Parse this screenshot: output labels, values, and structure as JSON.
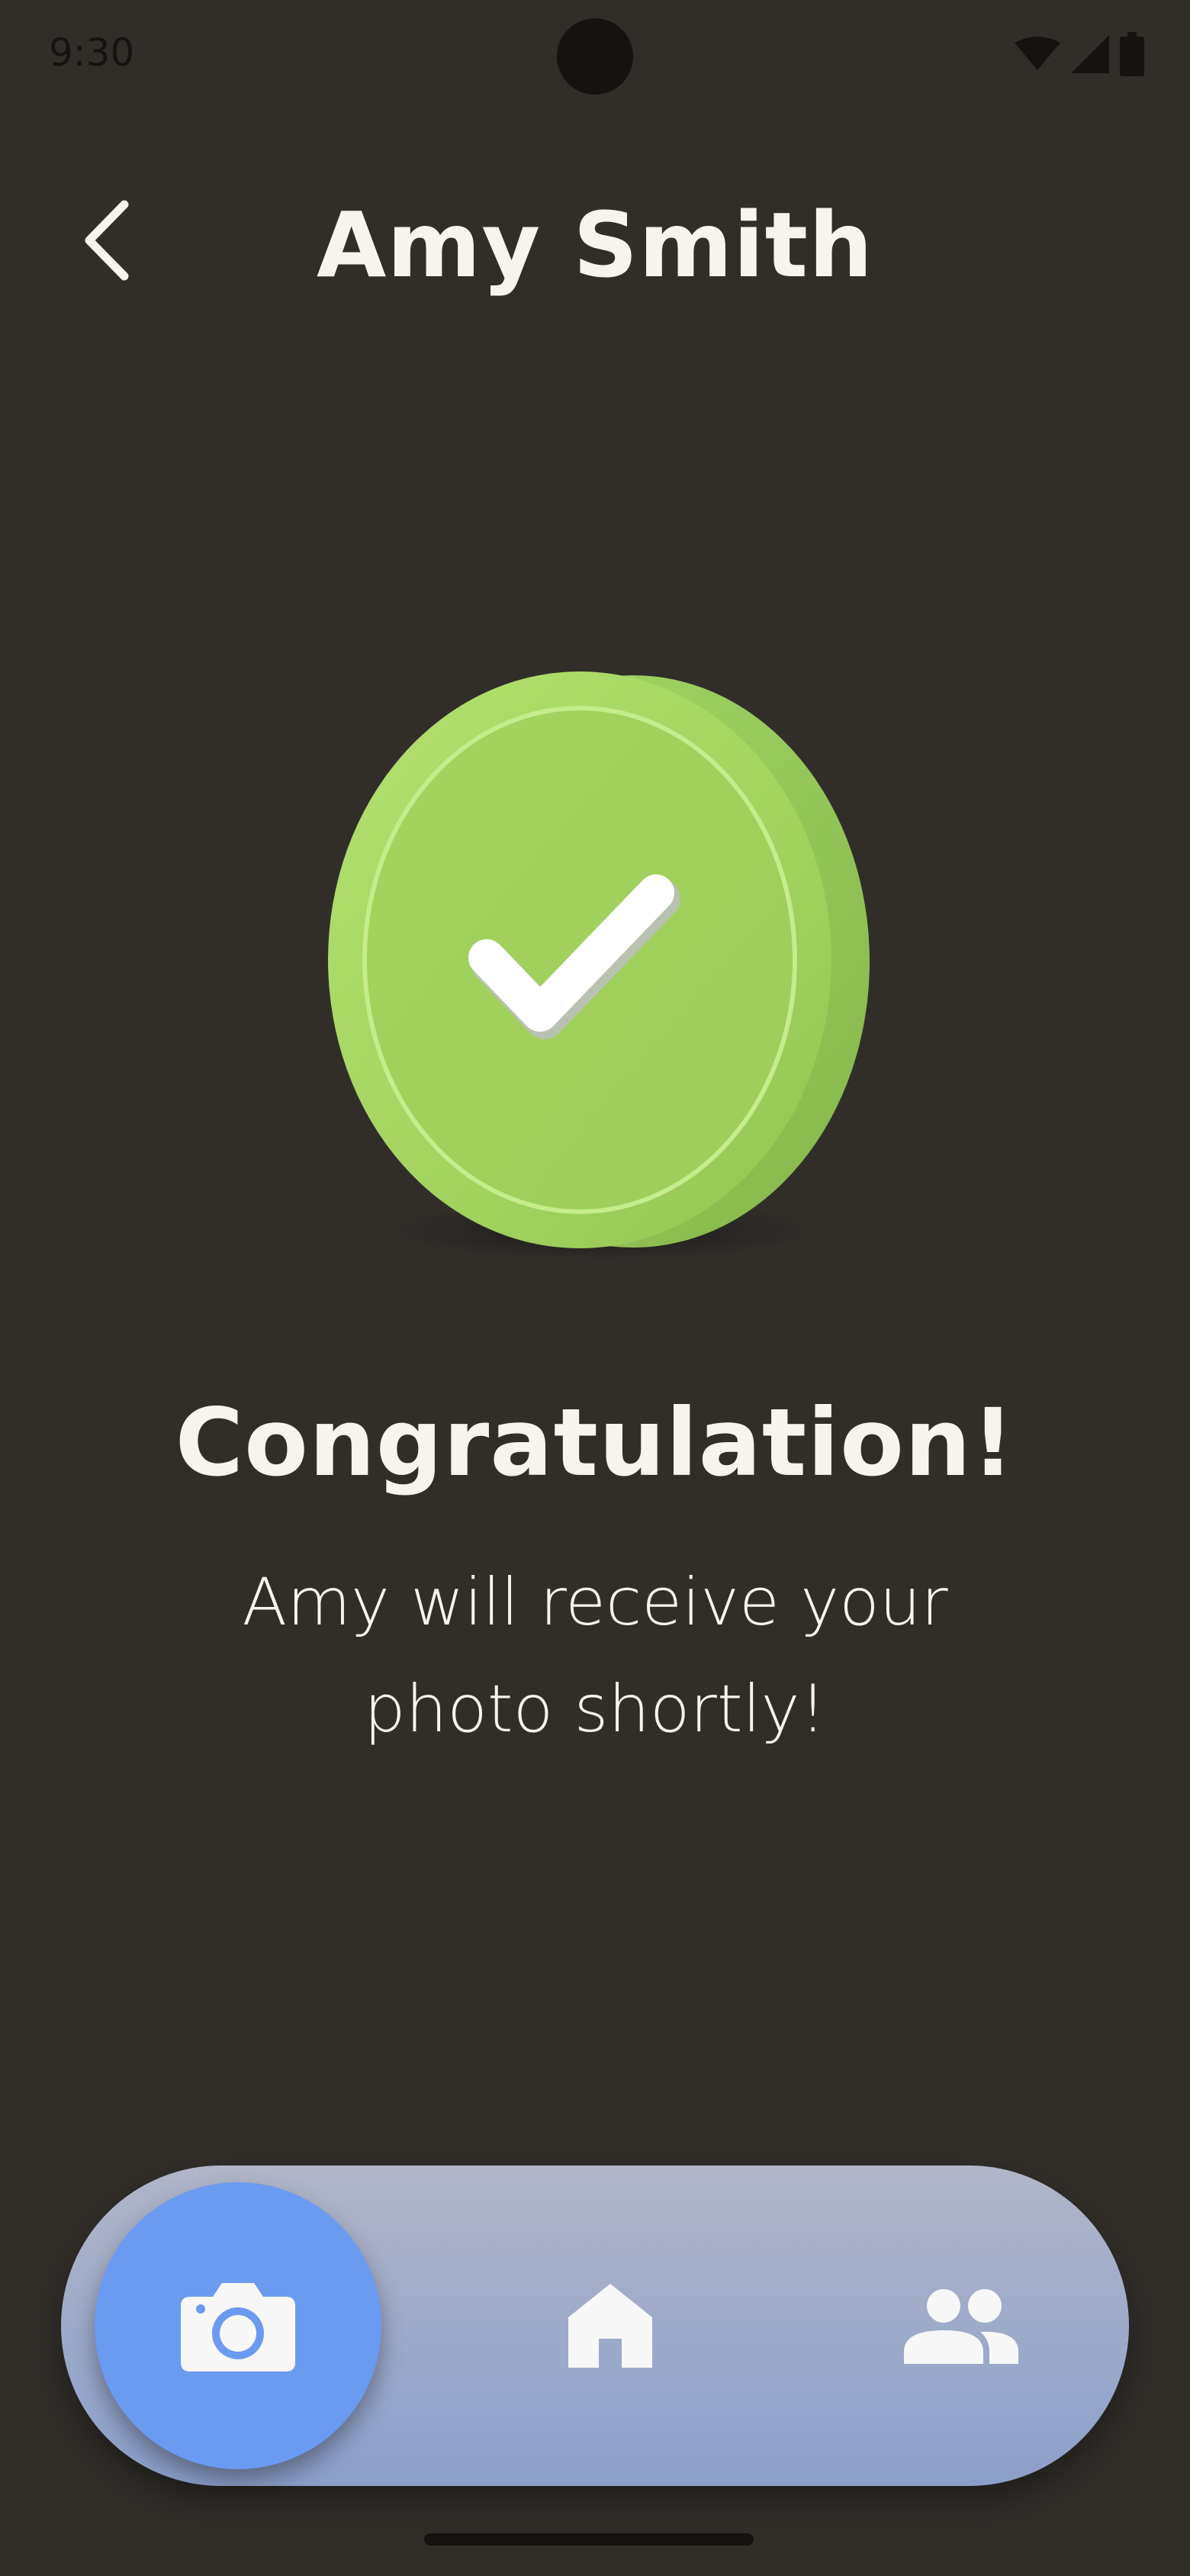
{
  "status_bar": {
    "time": "9:30",
    "icons": [
      "wifi-icon",
      "signal-icon",
      "battery-icon"
    ]
  },
  "header": {
    "title": "Amy Smith",
    "back_icon": "chevron-left-icon"
  },
  "main": {
    "illustration": "green-check-coin",
    "heading": "Congratulation!",
    "message": "Amy will receive your photo shortly!"
  },
  "bottom_nav": {
    "items": [
      {
        "icon": "camera-icon",
        "active": true
      },
      {
        "icon": "home-icon",
        "active": false
      },
      {
        "icon": "people-icon",
        "active": false
      }
    ]
  },
  "colors": {
    "background": "#312e2a",
    "text": "#f7f3ee",
    "accent_green": "#9fd05a",
    "nav_active": "#6b9af1",
    "nav_bar_top": "#b1b6c8",
    "nav_bar_bottom": "#8c9fca"
  }
}
